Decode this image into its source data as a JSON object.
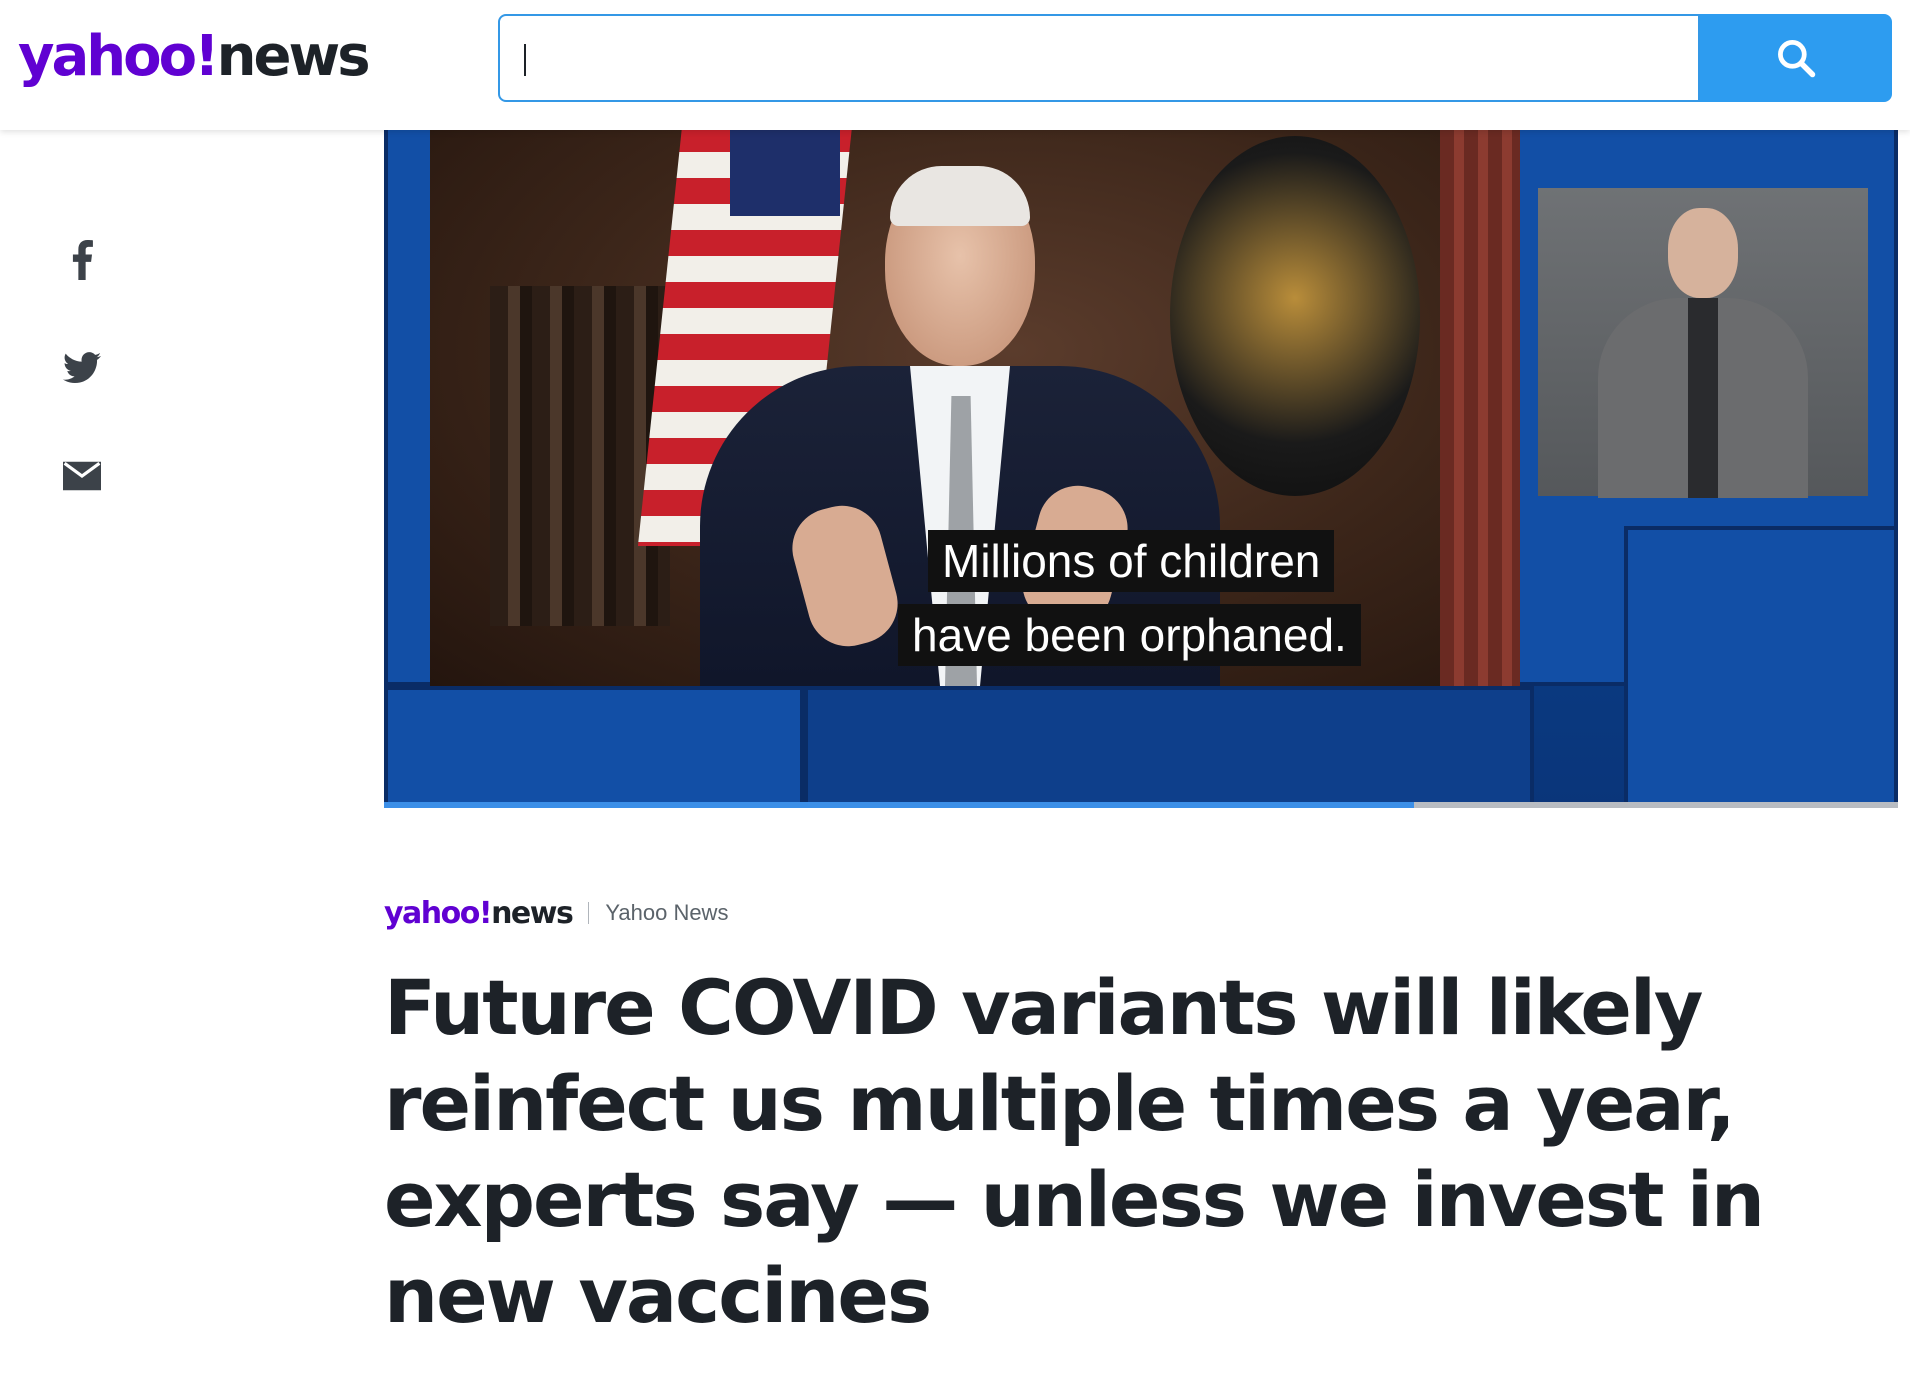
{
  "header": {
    "logo": {
      "brand": "yahoo!",
      "product": "news"
    },
    "search": {
      "value": "",
      "placeholder": ""
    },
    "search_icon": "search-icon"
  },
  "share": {
    "items": [
      {
        "icon": "facebook-icon"
      },
      {
        "icon": "twitter-icon"
      },
      {
        "icon": "email-icon"
      }
    ]
  },
  "video": {
    "captions": [
      "Millions of children",
      "have been orphaned."
    ],
    "progress": 0.68
  },
  "article": {
    "byline_logo": {
      "brand": "yahoo!",
      "product": "news"
    },
    "provider": "Yahoo News",
    "headline": "Future COVID variants will likely reinfect us multiple times a year, experts say — unless we invest in new vaccines"
  },
  "colors": {
    "brand_purple": "#6001d2",
    "search_blue": "#2d9cf0",
    "text": "#1d2228"
  }
}
